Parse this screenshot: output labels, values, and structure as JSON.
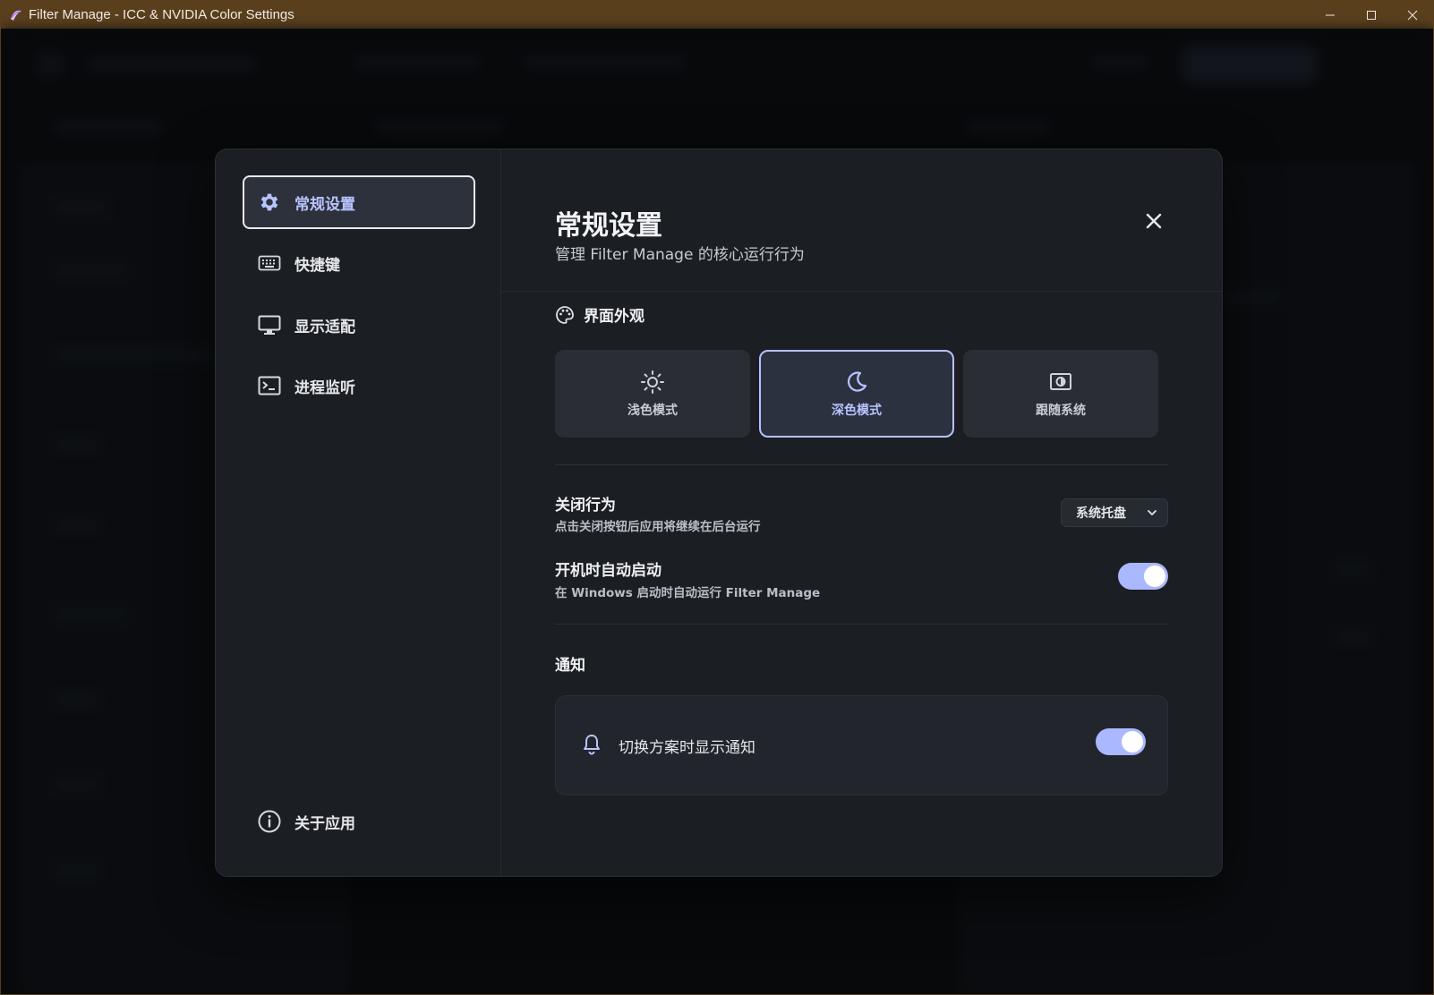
{
  "window": {
    "title": "Filter Manage - ICC & NVIDIA Color Settings",
    "controls": [
      "minimize-icon",
      "maximize-icon",
      "close-icon"
    ]
  },
  "sidebar": {
    "items": [
      {
        "label": "常规设置",
        "icon": "gear-icon",
        "active": true
      },
      {
        "label": "快捷键",
        "icon": "keyboard-icon",
        "active": false
      },
      {
        "label": "显示适配",
        "icon": "monitor-icon",
        "active": false
      },
      {
        "label": "进程监听",
        "icon": "terminal-icon",
        "active": false
      }
    ],
    "footer": {
      "label": "关于应用",
      "icon": "info-icon"
    }
  },
  "header": {
    "title": "常规设置",
    "subtitle": "管理 Filter Manage 的核心运行行为"
  },
  "appearance": {
    "heading": "界面外观",
    "icon": "palette-icon",
    "options": [
      {
        "label": "浅色模式",
        "icon": "sun-icon",
        "selected": false
      },
      {
        "label": "深色模式",
        "icon": "moon-icon",
        "selected": true
      },
      {
        "label": "跟随系统",
        "icon": "auto-theme-icon",
        "selected": false
      }
    ]
  },
  "close_behavior": {
    "title": "关闭行为",
    "description": "点击关闭按钮后应用将继续在后台运行",
    "value": "系统托盘"
  },
  "autostart": {
    "title": "开机时自动启动",
    "description": "在 Windows 启动时自动运行 Filter Manage",
    "enabled": true
  },
  "notifications": {
    "heading": "通知",
    "item_label": "切换方案时显示通知",
    "enabled": true
  },
  "colors": {
    "accent": "#b8c4ff",
    "titlebar": "#5a3f1d",
    "dialog_bg": "#1b1e23"
  }
}
